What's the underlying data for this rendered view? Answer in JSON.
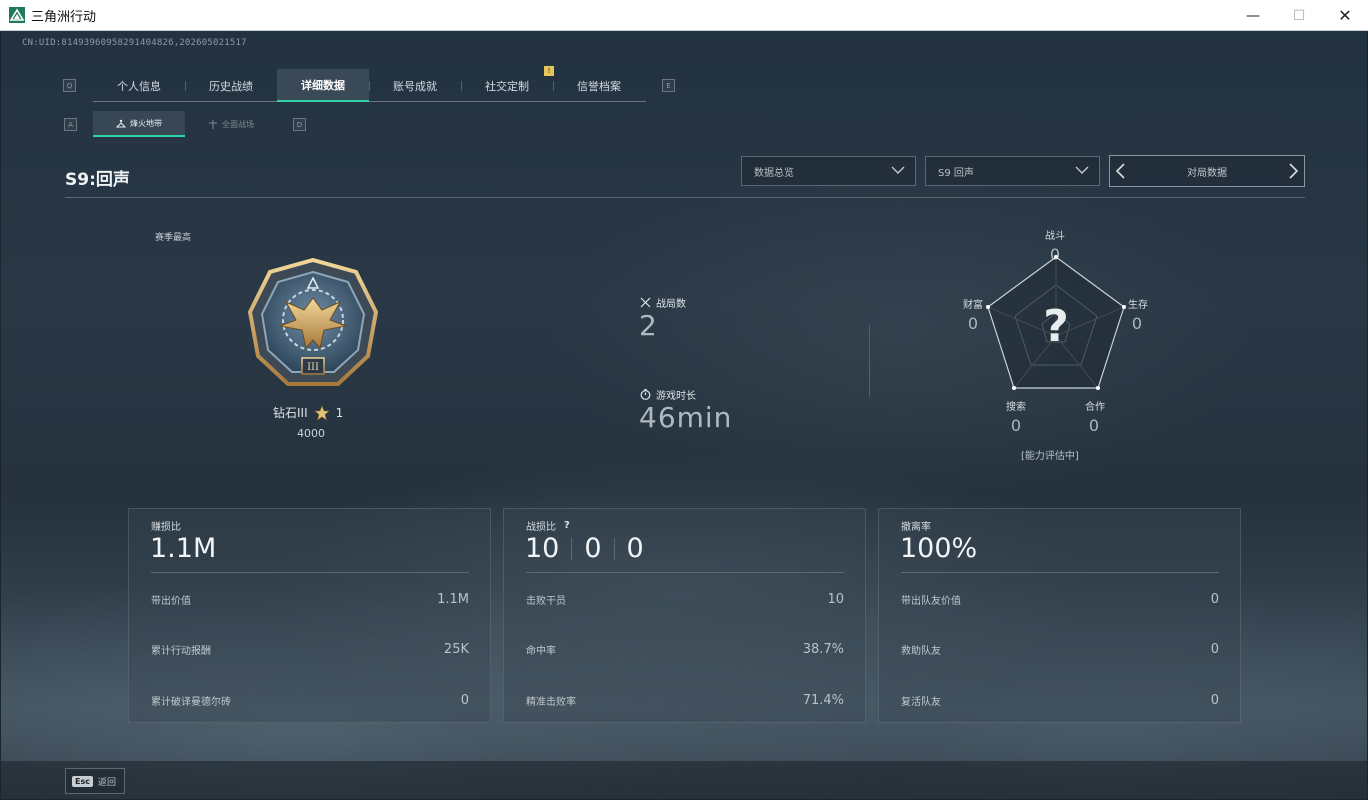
{
  "window": {
    "title": "三角洲行动",
    "min": "—",
    "max": "☐",
    "close": "✕"
  },
  "uid": "CN:UID:8149396095829140482​6,202605021517",
  "tabs": {
    "left_key": "Q",
    "right_key": "E",
    "items": [
      "个人信息",
      "历史战绩",
      "详细数据",
      "账号成就",
      "社交定制",
      "信誉档案"
    ],
    "active": "详细数据",
    "badge": "!"
  },
  "subtabs": {
    "left_key": "A",
    "right_key": "D",
    "items": [
      "烽火地带",
      "全面战场"
    ],
    "active": "烽火地带"
  },
  "header": {
    "season_title": "S9:回声",
    "dropdown_1": "数据总览",
    "dropdown_2": "S9 回声",
    "pager": "对局数据"
  },
  "rank": {
    "label": "赛季最高",
    "name": "钻石III",
    "stars": "1",
    "score": "4000"
  },
  "middle": {
    "matches_label": "战局数",
    "matches_value": "2",
    "time_label": "游戏时长",
    "time_value": "46min"
  },
  "radar": {
    "combat_label": "战斗",
    "combat_value": "0",
    "survival_label": "生存",
    "survival_value": "0",
    "teamwork_label": "合作",
    "teamwork_value": "0",
    "search_label": "搜索",
    "search_value": "0",
    "wealth_label": "财富",
    "wealth_value": "0",
    "center": "?",
    "note": "[能力评估中]"
  },
  "cards": {
    "profit": {
      "title": "赚损比",
      "big": "1.1M",
      "rows": [
        {
          "label": "带出价值",
          "value": "1.1M"
        },
        {
          "label": "累计行动报酬",
          "value": "25K"
        },
        {
          "label": "累计破译曼德尔砖",
          "value": "0"
        }
      ]
    },
    "kd": {
      "title": "战损比",
      "help": "?",
      "big": [
        "10",
        "0",
        "0"
      ],
      "rows": [
        {
          "label": "击败干员",
          "value": "10"
        },
        {
          "label": "命中率",
          "value": "38.7%"
        },
        {
          "label": "精准击败率",
          "value": "71.4%"
        }
      ]
    },
    "extract": {
      "title": "撤离率",
      "big": "100%",
      "rows": [
        {
          "label": "带出队友价值",
          "value": "0"
        },
        {
          "label": "救助队友",
          "value": "0"
        },
        {
          "label": "复活队友",
          "value": "0"
        }
      ]
    }
  },
  "footer": {
    "esc_key": "Esc",
    "back_label": "返回"
  }
}
